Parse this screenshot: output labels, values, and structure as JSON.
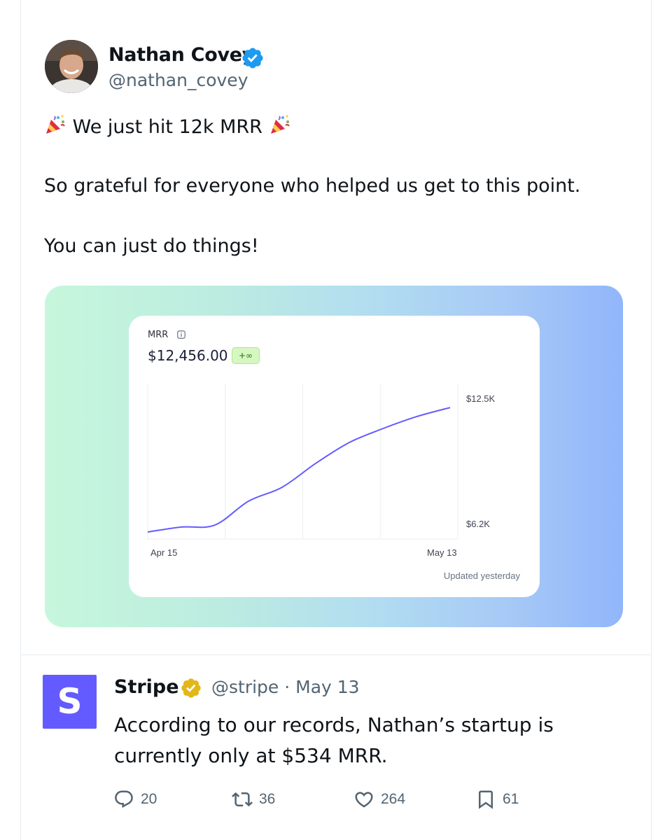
{
  "tweet": {
    "author": {
      "name": "Nathan Covey",
      "handle": "@nathan_covey",
      "verified": true
    },
    "lines": [
      "We just hit 12k MRR",
      "So grateful for everyone who helped us get to this point.",
      "You can just do things!"
    ],
    "emoji": "party-popper-icon"
  },
  "media": {
    "label": "MRR",
    "value": "$12,456.00",
    "badge": "+∞",
    "updated": "Updated yesterday",
    "chart_data": {
      "type": "line",
      "x_labels": [
        "Apr 15",
        "May 13"
      ],
      "y_tick_labels": [
        "$12.5K",
        "$6.2K"
      ],
      "ylim": [
        6200,
        12500
      ],
      "x": [
        "Apr 15",
        "Apr 19",
        "Apr 22",
        "Apr 26",
        "Apr 29",
        "May 2",
        "May 5",
        "May 8",
        "May 11",
        "May 13"
      ],
      "values": [
        6200,
        6450,
        6550,
        7750,
        8450,
        9650,
        10700,
        11400,
        12000,
        12456
      ],
      "grid": true
    }
  },
  "quote": {
    "name": "Stripe",
    "meta": "@stripe · May 13",
    "logo_letter": "S",
    "brand_color": "#635bff",
    "lines": [
      "According to our records, Nathan’s startup is",
      "currently only at $534 MRR."
    ]
  },
  "actions": {
    "replies": "20",
    "retweets": "36",
    "likes": "264",
    "bookmarks": "61"
  }
}
